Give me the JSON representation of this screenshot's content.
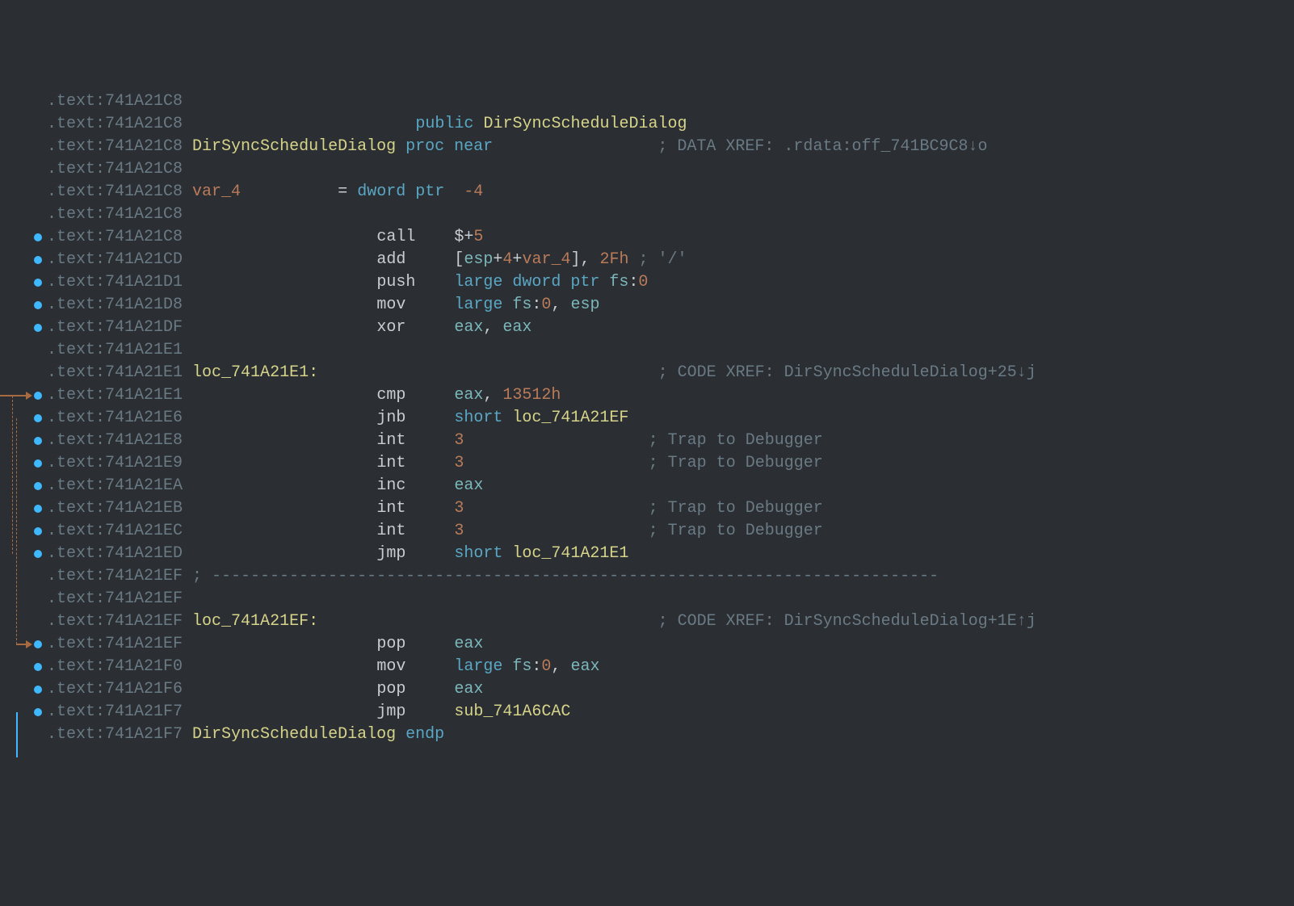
{
  "lines": [
    {
      "addr": "741A21C8",
      "bp": false,
      "arrow": null
    },
    {
      "addr": "741A21C8",
      "bp": false,
      "arrow": null,
      "col_kw": "public",
      "col_name": "DirSyncScheduleDialog"
    },
    {
      "addr": "741A21C8",
      "bp": false,
      "arrow": null,
      "proc_name": "DirSyncScheduleDialog",
      "proc_kw": "proc near",
      "xref": "; DATA XREF: .rdata:off_741BC9C8↓o"
    },
    {
      "addr": "741A21C8",
      "bp": false,
      "arrow": null
    },
    {
      "addr": "741A21C8",
      "bp": false,
      "arrow": null,
      "var_name": "var_4",
      "var_eq": "=",
      "var_type": "dword ptr",
      "var_off": "-4"
    },
    {
      "addr": "741A21C8",
      "bp": false,
      "arrow": null
    },
    {
      "addr": "741A21C8",
      "bp": true,
      "arrow": null,
      "mnem": "call",
      "ops": [
        {
          "t": "op-w",
          "v": "$+"
        },
        {
          "t": "num",
          "v": "5"
        }
      ]
    },
    {
      "addr": "741A21CD",
      "bp": true,
      "arrow": null,
      "mnem": "add",
      "ops": [
        {
          "t": "op-w",
          "v": "["
        },
        {
          "t": "reg",
          "v": "esp"
        },
        {
          "t": "op-w",
          "v": "+"
        },
        {
          "t": "num",
          "v": "4"
        },
        {
          "t": "op-w",
          "v": "+"
        },
        {
          "t": "num",
          "v": "var_4"
        },
        {
          "t": "op-w",
          "v": "], "
        },
        {
          "t": "num",
          "v": "2Fh"
        },
        {
          "t": "comment",
          "v": " ; '/'"
        }
      ]
    },
    {
      "addr": "741A21D1",
      "bp": true,
      "arrow": null,
      "mnem": "push",
      "ops": [
        {
          "t": "kw-blue",
          "v": "large dword ptr "
        },
        {
          "t": "reg",
          "v": "fs"
        },
        {
          "t": "op-w",
          "v": ":"
        },
        {
          "t": "num",
          "v": "0"
        }
      ]
    },
    {
      "addr": "741A21D8",
      "bp": true,
      "arrow": null,
      "mnem": "mov",
      "ops": [
        {
          "t": "kw-blue",
          "v": "large "
        },
        {
          "t": "reg",
          "v": "fs"
        },
        {
          "t": "op-w",
          "v": ":"
        },
        {
          "t": "num",
          "v": "0"
        },
        {
          "t": "op-w",
          "v": ", "
        },
        {
          "t": "reg",
          "v": "esp"
        }
      ]
    },
    {
      "addr": "741A21DF",
      "bp": true,
      "arrow": null,
      "mnem": "xor",
      "ops": [
        {
          "t": "reg",
          "v": "eax"
        },
        {
          "t": "op-w",
          "v": ", "
        },
        {
          "t": "reg",
          "v": "eax"
        }
      ]
    },
    {
      "addr": "741A21E1",
      "bp": false,
      "arrow": null
    },
    {
      "addr": "741A21E1",
      "bp": false,
      "arrow": null,
      "label": "loc_741A21E1:",
      "xref": "; CODE XREF: DirSyncScheduleDialog+25↓j"
    },
    {
      "addr": "741A21E1",
      "bp": true,
      "arrow": "in",
      "mnem": "cmp",
      "ops": [
        {
          "t": "reg",
          "v": "eax"
        },
        {
          "t": "op-w",
          "v": ", "
        },
        {
          "t": "num",
          "v": "13512h"
        }
      ]
    },
    {
      "addr": "741A21E6",
      "bp": true,
      "arrow": null,
      "mnem": "jnb",
      "ops": [
        {
          "t": "kw-blue",
          "v": "short "
        },
        {
          "t": "name-y",
          "v": "loc_741A21EF"
        }
      ]
    },
    {
      "addr": "741A21E8",
      "bp": true,
      "arrow": null,
      "mnem": "int",
      "ops": [
        {
          "t": "num",
          "v": "3"
        }
      ],
      "trail": "; Trap to Debugger"
    },
    {
      "addr": "741A21E9",
      "bp": true,
      "arrow": null,
      "mnem": "int",
      "ops": [
        {
          "t": "num",
          "v": "3"
        }
      ],
      "trail": "; Trap to Debugger"
    },
    {
      "addr": "741A21EA",
      "bp": true,
      "arrow": null,
      "mnem": "inc",
      "ops": [
        {
          "t": "reg",
          "v": "eax"
        }
      ]
    },
    {
      "addr": "741A21EB",
      "bp": true,
      "arrow": null,
      "mnem": "int",
      "ops": [
        {
          "t": "num",
          "v": "3"
        }
      ],
      "trail": "; Trap to Debugger"
    },
    {
      "addr": "741A21EC",
      "bp": true,
      "arrow": null,
      "mnem": "int",
      "ops": [
        {
          "t": "num",
          "v": "3"
        }
      ],
      "trail": "; Trap to Debugger"
    },
    {
      "addr": "741A21ED",
      "bp": true,
      "arrow": null,
      "mnem": "jmp",
      "ops": [
        {
          "t": "kw-blue",
          "v": "short "
        },
        {
          "t": "name-y",
          "v": "loc_741A21E1"
        }
      ]
    },
    {
      "addr": "741A21EF",
      "bp": false,
      "arrow": null,
      "dash": true
    },
    {
      "addr": "741A21EF",
      "bp": false,
      "arrow": null
    },
    {
      "addr": "741A21EF",
      "bp": false,
      "arrow": null,
      "label": "loc_741A21EF:",
      "xref": "; CODE XREF: DirSyncScheduleDialog+1E↑j"
    },
    {
      "addr": "741A21EF",
      "bp": true,
      "arrow": "short",
      "mnem": "pop",
      "ops": [
        {
          "t": "reg",
          "v": "eax"
        }
      ]
    },
    {
      "addr": "741A21F0",
      "bp": true,
      "arrow": null,
      "mnem": "mov",
      "ops": [
        {
          "t": "kw-blue",
          "v": "large "
        },
        {
          "t": "reg",
          "v": "fs"
        },
        {
          "t": "op-w",
          "v": ":"
        },
        {
          "t": "num",
          "v": "0"
        },
        {
          "t": "op-w",
          "v": ", "
        },
        {
          "t": "reg",
          "v": "eax"
        }
      ]
    },
    {
      "addr": "741A21F6",
      "bp": true,
      "arrow": null,
      "mnem": "pop",
      "ops": [
        {
          "t": "reg",
          "v": "eax"
        }
      ]
    },
    {
      "addr": "741A21F7",
      "bp": true,
      "arrow": null,
      "mnem": "jmp",
      "ops": [
        {
          "t": "name-y",
          "v": "sub_741A6CAC"
        }
      ]
    },
    {
      "addr": "741A21F7",
      "bp": false,
      "arrow": null,
      "endp_name": "DirSyncScheduleDialog",
      "endp_kw": "endp"
    }
  ],
  "seg_prefix": ".text:",
  "dash_seg": " ; ---------------------------------------------------------------------------",
  "cols": {
    "label": 15,
    "mnem": 35,
    "ops": 45,
    "trail": 64,
    "xref": 64
  }
}
